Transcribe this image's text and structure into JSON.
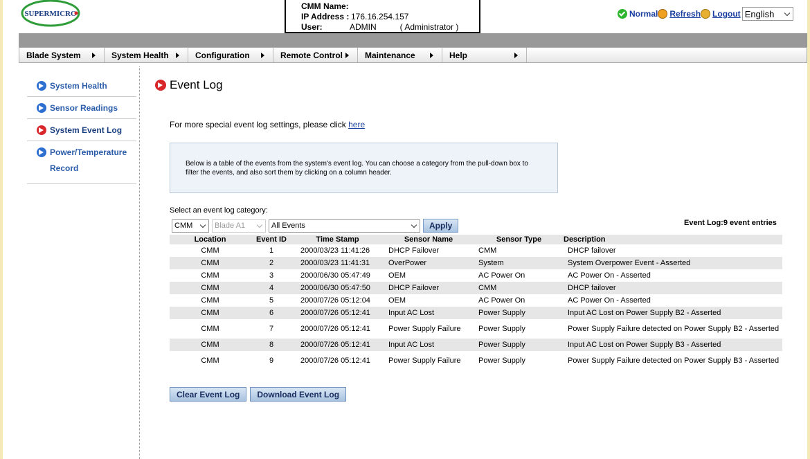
{
  "header": {
    "logo_text": "SUPERMICRO",
    "info": {
      "cmm_name_label": "CMM Name:",
      "cmm_name_value": "",
      "ip_label": "IP Address :",
      "ip_value": "176.16.254.157",
      "user_label": "User:",
      "user_value": "ADMIN",
      "user_role": "( Administrator )"
    },
    "status_label": "Normal",
    "refresh_label": "Refresh",
    "logout_label": "Logout",
    "language_selected": "English"
  },
  "nav": {
    "items": [
      {
        "label": "Blade System",
        "width": 123
      },
      {
        "label": "System Health",
        "width": 121
      },
      {
        "label": "Configuration",
        "width": 123
      },
      {
        "label": "Remote Control",
        "width": 122
      },
      {
        "label": "Maintenance",
        "width": 122
      },
      {
        "label": "Help",
        "width": 122
      }
    ]
  },
  "sidebar": {
    "items": [
      {
        "label": "System Health",
        "icon": "arrow-right-circle-icon",
        "color": "#2d6fd0"
      },
      {
        "label": "Sensor Readings",
        "icon": "arrow-right-circle-icon",
        "color": "#2d6fd0"
      },
      {
        "label": "System Event Log",
        "icon": "arrow-right-circle-icon",
        "color": "#d8262a"
      },
      {
        "label": "Power/Temperature Record",
        "icon": "arrow-right-circle-icon",
        "color": "#2d6fd0"
      }
    ]
  },
  "main": {
    "title": "Event Log",
    "settings_text": "For more special event log settings, please click ",
    "settings_link": "here",
    "description": "Below is a table of the events from the system's event log. You can choose a category from the pull-down box to filter the events, and also sort them by clicking on a column header.",
    "category_label": "Select an event log category:",
    "filter_location": "CMM",
    "filter_blade": "Blade A1",
    "filter_events": "All Events",
    "apply_label": "Apply",
    "entries_summary": "Event Log:9 event entries",
    "columns": [
      "Location",
      "Event ID",
      "Time Stamp",
      "Sensor Name",
      "Sensor Type",
      "Description"
    ],
    "rows": [
      [
        "CMM",
        "1",
        "2000/03/23 11:41:26",
        "DHCP Failover",
        "CMM",
        "DHCP failover"
      ],
      [
        "CMM",
        "2",
        "2000/03/23 11:41:31",
        "OverPower",
        "System",
        "System Overpower Event - Asserted"
      ],
      [
        "CMM",
        "3",
        "2000/06/30 05:47:49",
        "OEM",
        "AC Power On",
        "AC Power On - Asserted"
      ],
      [
        "CMM",
        "4",
        "2000/06/30 05:47:50",
        "DHCP Failover",
        "CMM",
        "DHCP failover"
      ],
      [
        "CMM",
        "5",
        "2000/07/26 05:12:04",
        "OEM",
        "AC Power On",
        "AC Power On - Asserted"
      ],
      [
        "CMM",
        "6",
        "2000/07/26 05:12:41",
        "Input AC Lost",
        "Power Supply",
        "Input AC Lost on Power Supply B2 - Asserted"
      ],
      [
        "CMM",
        "7",
        "2000/07/26 05:12:41",
        "Power Supply Failure",
        "Power Supply",
        "Power Supply Failure detected on Power Supply B2 - Asserted"
      ],
      [
        "CMM",
        "8",
        "2000/07/26 05:12:41",
        "Input AC Lost",
        "Power Supply",
        "Input AC Lost on Power Supply B3 - Asserted"
      ],
      [
        "CMM",
        "9",
        "2000/07/26 05:12:41",
        "Power Supply Failure",
        "Power Supply",
        "Power Supply Failure detected on Power Supply B3 - Asserted"
      ]
    ],
    "clear_label": "Clear Event Log",
    "download_label": "Download Event Log"
  }
}
